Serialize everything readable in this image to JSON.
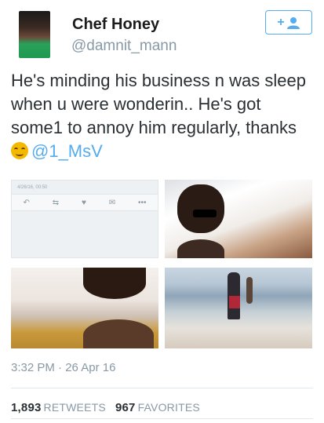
{
  "author": {
    "name": "Chef Honey",
    "handle": "@damnit_mann"
  },
  "follow_button": {
    "label": "+",
    "icon": "add-user-icon"
  },
  "tweet": {
    "text": "He's minding his business n was sleep when u were wonderin.. He's got some1 to annoy him regularly, thanks",
    "emoji": "smiling-face-emoji",
    "mention": "@1_MsV"
  },
  "media": {
    "embedded_tweet_date": "4/26/16, 00:50",
    "embedded_actions": [
      "reply-icon",
      "retweet-icon",
      "heart-icon",
      "dm-icon",
      "more-icon"
    ],
    "images": [
      "screenshot-of-tweet",
      "couple-photo",
      "sleeping-with-baby-photo",
      "beach-photo"
    ]
  },
  "timestamp": "3:32 PM · 26 Apr 16",
  "stats": {
    "retweets_count": "1,893",
    "retweets_label": "RETWEETS",
    "favorites_count": "967",
    "favorites_label": "FAVORITES"
  },
  "colors": {
    "accent": "#55acee",
    "muted": "#8899a6",
    "text": "#292f33"
  }
}
